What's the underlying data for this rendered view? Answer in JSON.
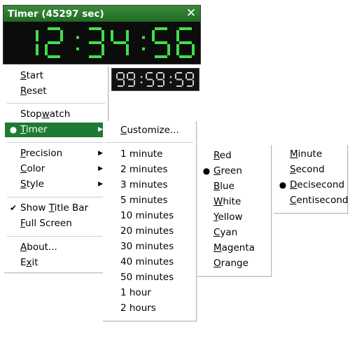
{
  "window": {
    "title": "Timer (45297 sec)",
    "close_glyph": "✕",
    "display": "12:34:56.0",
    "mini_display": "99:59:59",
    "colors": {
      "titlebar": "#2c7d2f",
      "digit": "#3ee04a",
      "mini_digit": "#d0d0d0"
    }
  },
  "main_menu": {
    "items": [
      {
        "label": "Start",
        "mnemonic": "S"
      },
      {
        "label": "Reset",
        "mnemonic": "R"
      },
      {
        "label": "Stopwatch",
        "mnemonic": "w"
      },
      {
        "label": "Timer",
        "mnemonic": "T",
        "checked": "dot",
        "submenu": true,
        "highlighted": true
      },
      {
        "label": "Precision",
        "mnemonic": "P",
        "submenu": true
      },
      {
        "label": "Color",
        "mnemonic": "C",
        "submenu": true
      },
      {
        "label": "Style",
        "mnemonic": "S",
        "submenu": true
      },
      {
        "label": "Show Title Bar",
        "mnemonic": "T",
        "checked": "check"
      },
      {
        "label": "Full Screen",
        "mnemonic": "F"
      },
      {
        "label": "About...",
        "mnemonic": "A"
      },
      {
        "label": "Exit",
        "mnemonic": "x"
      }
    ],
    "highlight_color": "#1f7a33"
  },
  "timer_menu": {
    "items": [
      {
        "label": "Customize...",
        "mnemonic": "C"
      },
      {
        "label": "1 minute"
      },
      {
        "label": "2 minutes"
      },
      {
        "label": "3 minutes"
      },
      {
        "label": "5 minutes"
      },
      {
        "label": "10 minutes"
      },
      {
        "label": "20 minutes"
      },
      {
        "label": "30 minutes"
      },
      {
        "label": "40 minutes"
      },
      {
        "label": "50 minutes"
      },
      {
        "label": "1 hour"
      },
      {
        "label": "2 hours"
      }
    ]
  },
  "color_menu": {
    "items": [
      {
        "label": "Red",
        "mnemonic": "R"
      },
      {
        "label": "Green",
        "mnemonic": "G",
        "checked": "dot"
      },
      {
        "label": "Blue",
        "mnemonic": "B"
      },
      {
        "label": "White",
        "mnemonic": "W"
      },
      {
        "label": "Yellow",
        "mnemonic": "Y"
      },
      {
        "label": "Cyan",
        "mnemonic": "C"
      },
      {
        "label": "Magenta",
        "mnemonic": "M"
      },
      {
        "label": "Orange",
        "mnemonic": "O"
      }
    ]
  },
  "precision_menu": {
    "items": [
      {
        "label": "Minute",
        "mnemonic": "M"
      },
      {
        "label": "Second",
        "mnemonic": "S"
      },
      {
        "label": "Decisecond",
        "mnemonic": "D",
        "checked": "dot"
      },
      {
        "label": "Centisecond",
        "mnemonic": "C"
      }
    ]
  }
}
